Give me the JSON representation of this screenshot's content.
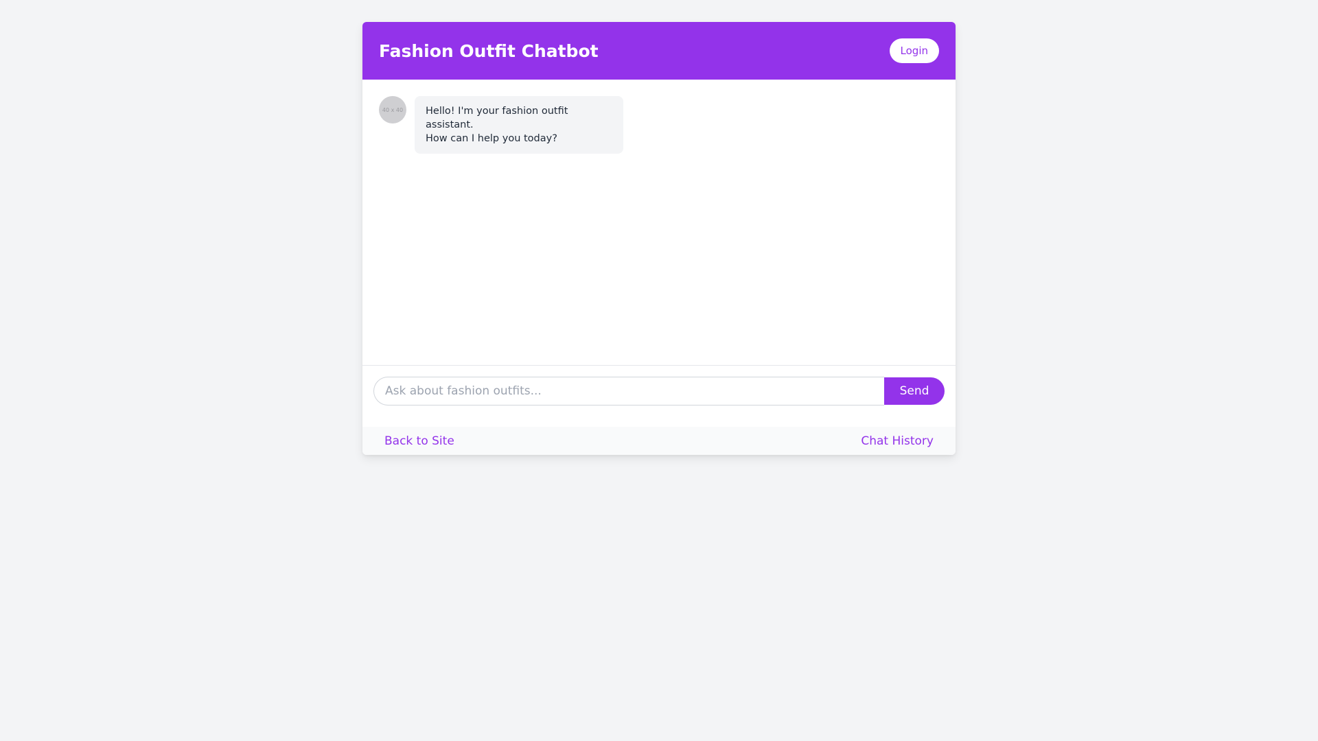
{
  "header": {
    "title": "Fashion Outfit Chatbot",
    "login_label": "Login"
  },
  "messages": [
    {
      "sender": "bot",
      "avatar_text": "40 x 40",
      "text": "Hello! I'm your fashion outfit assistant.\nHow can I help you today?"
    }
  ],
  "composer": {
    "placeholder": "Ask about fashion outfits...",
    "value": "",
    "send_label": "Send"
  },
  "footer": {
    "back_label": "Back to Site",
    "history_label": "Chat History"
  },
  "colors": {
    "accent": "#9333ea",
    "page_background": "#f3f4f6",
    "bubble_background": "#f3f4f6",
    "footer_background": "#f9fafb"
  }
}
